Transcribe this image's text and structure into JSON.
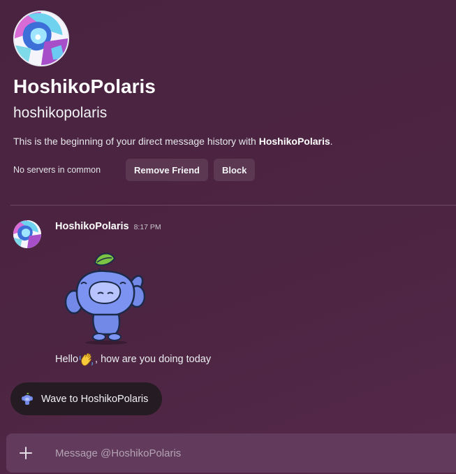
{
  "profile": {
    "display_name": "HoshikoPolaris",
    "username": "hoshikopolaris",
    "intro_prefix": "This is the beginning of your direct message history with ",
    "intro_name": "HoshikoPolaris",
    "intro_suffix": ".",
    "servers_in_common": "No servers in common",
    "remove_friend_label": "Remove Friend",
    "block_label": "Block"
  },
  "message": {
    "author": "HoshikoPolaris",
    "time": "8:17 PM",
    "sticker": "wumpus-waving-sticker",
    "text_before": "Hello",
    "emoji": "waving-hand-emoji",
    "text_after": ", how are you doing today"
  },
  "wave_button": {
    "label": "Wave to HoshikoPolaris",
    "icon": "wumpus-icon"
  },
  "composer": {
    "placeholder": "Message @HoshikoPolaris",
    "attach_icon": "plus-icon"
  },
  "colors": {
    "background": "#4c2542",
    "composer": "#613a5c",
    "wave_button": "#251b22"
  }
}
